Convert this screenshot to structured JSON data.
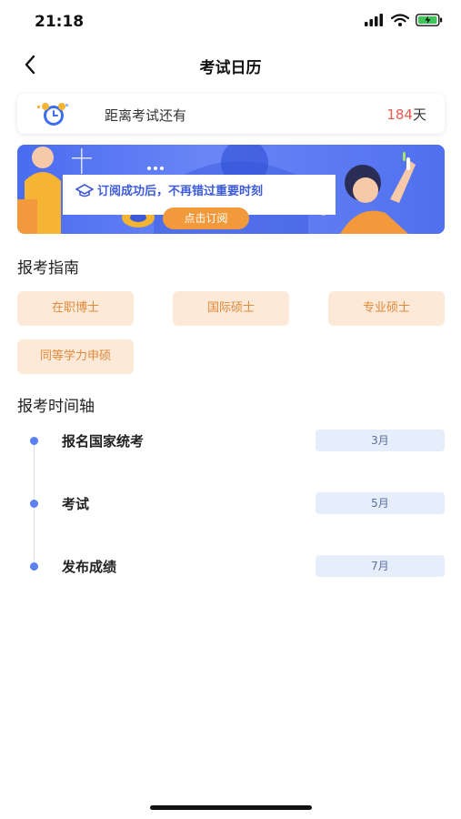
{
  "status_bar": {
    "time": "21:18"
  },
  "nav": {
    "title": "考试日历"
  },
  "countdown": {
    "label": "距离考试还有",
    "days": "184",
    "unit": "天"
  },
  "banner": {
    "text": "订阅成功后，不再错过重要时刻",
    "button_label": "点击订阅"
  },
  "guide": {
    "title": "报考指南",
    "chips": [
      "在职博士",
      "国际硕士",
      "专业硕士",
      "同等学力申硕"
    ]
  },
  "timeline": {
    "title": "报考时间轴",
    "items": [
      {
        "label": "报名国家统考",
        "month": "3月"
      },
      {
        "label": "考试",
        "month": "5月"
      },
      {
        "label": "发布成绩",
        "month": "7月"
      }
    ]
  },
  "colors": {
    "accent_orange": "#e08a3c",
    "chip_bg": "#fde9d7",
    "countdown_number": "#e85a4f",
    "banner_blue": "#4a6cf0"
  }
}
